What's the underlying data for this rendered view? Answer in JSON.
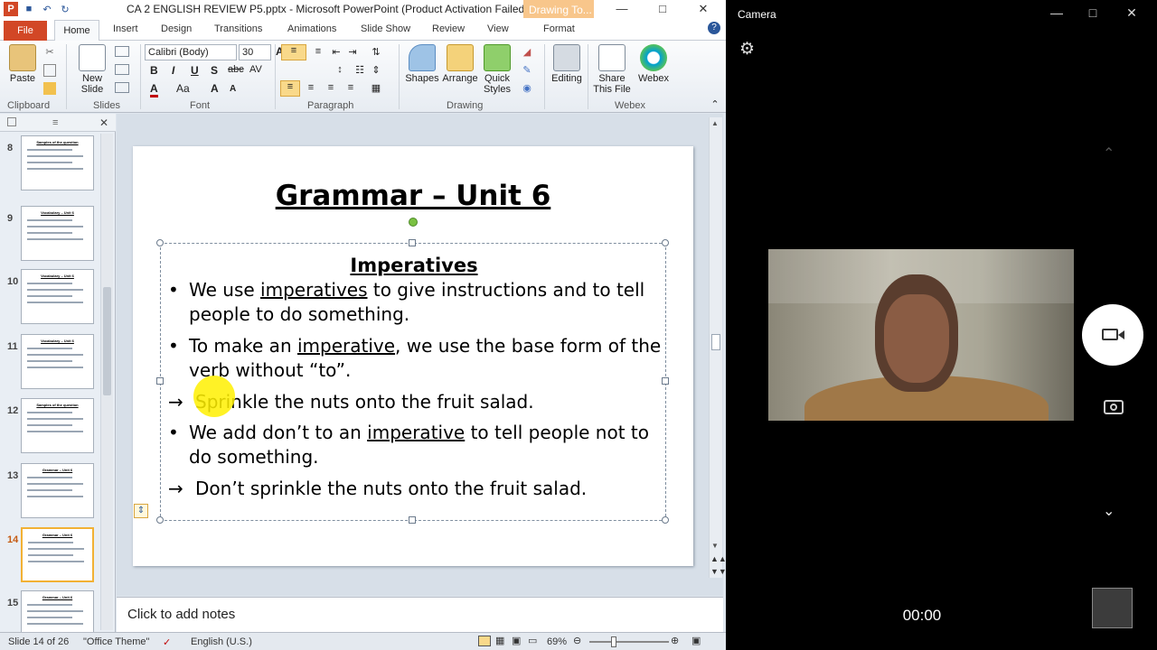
{
  "app": {
    "title": "CA 2 ENGLISH REVIEW P5.pptx - Microsoft PowerPoint (Product Activation Failed)",
    "context_tab": "Drawing To...",
    "tabs": [
      "File",
      "Home",
      "Insert",
      "Design",
      "Transitions",
      "Animations",
      "Slide Show",
      "Review",
      "View",
      "Format"
    ]
  },
  "ribbon": {
    "clipboard": {
      "paste": "Paste",
      "label": "Clipboard"
    },
    "slides": {
      "new_slide": "New Slide",
      "label": "Slides"
    },
    "font": {
      "name": "Calibri (Body)",
      "size": "30",
      "label": "Font",
      "bold": "B",
      "italic": "I",
      "underline": "U",
      "shadow": "S",
      "strike": "abc",
      "spacing": "AV",
      "color": "A",
      "case": "Aa",
      "grow": "A",
      "shrink": "A"
    },
    "paragraph": {
      "label": "Paragraph"
    },
    "drawing": {
      "shapes": "Shapes",
      "arrange": "Arrange",
      "quick_styles": "Quick Styles",
      "label": "Drawing"
    },
    "editing": {
      "label": "Editing"
    },
    "webex": {
      "share": "Share This File",
      "webex": "Webex",
      "label": "Webex"
    }
  },
  "thumbnails": [
    {
      "num": "8",
      "title": "Samples of the question"
    },
    {
      "num": "9",
      "title": "Vocabulary – Unit 6"
    },
    {
      "num": "10",
      "title": "Vocabulary – Unit 6"
    },
    {
      "num": "11",
      "title": "Vocabulary – Unit 6"
    },
    {
      "num": "12",
      "title": "Samples of the question"
    },
    {
      "num": "13",
      "title": "Grammar – Unit 6"
    },
    {
      "num": "14",
      "title": "Grammar – Unit 6"
    },
    {
      "num": "15",
      "title": "Grammar – Unit 6"
    }
  ],
  "slide": {
    "title": "Grammar – Unit 6",
    "heading": "Imperatives",
    "p1_pre": "We use ",
    "p1_u": "imperatives",
    "p1_post": " to give instructions and to tell people to do something.",
    "p2_pre": "To make an ",
    "p2_u": "imperative",
    "p2_post": ", we use the base form of the verb without “to”.",
    "ex1": "Sprinkle the nuts onto the fruit salad.",
    "p3_pre": "We add don’t to an ",
    "p3_u": "imperative",
    "p3_post": " to tell people not to do something.",
    "ex2": "Don’t sprinkle the nuts onto the fruit salad."
  },
  "notes": {
    "placeholder": "Click to add notes"
  },
  "status": {
    "slide": "Slide 14 of 26",
    "theme": "\"Office Theme\"",
    "language": "English (U.S.)",
    "zoom": "69%"
  },
  "camera": {
    "title": "Camera",
    "timer": "00:00"
  }
}
